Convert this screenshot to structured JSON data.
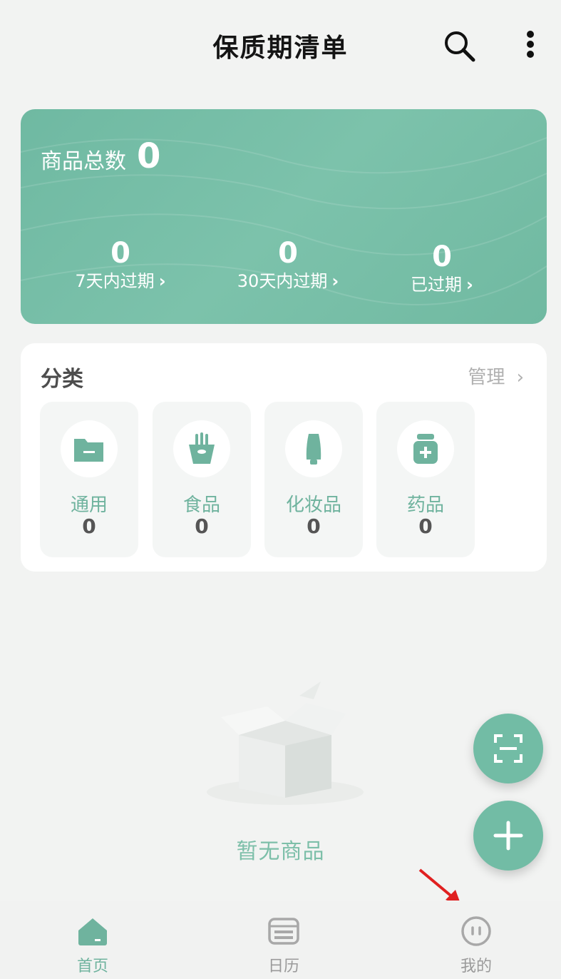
{
  "header": {
    "title": "保质期清单",
    "search_icon": "search-icon",
    "more_icon": "more-vertical-icon"
  },
  "stats": {
    "total_label": "商品总数",
    "total_value": "0",
    "items": [
      {
        "value": "0",
        "label": "7天内过期",
        "chevron": "›"
      },
      {
        "value": "0",
        "label": "30天内过期",
        "chevron": "›"
      },
      {
        "value": "0",
        "label": "已过期",
        "chevron": "›"
      }
    ]
  },
  "categories": {
    "title": "分类",
    "manage_label": "管理",
    "manage_chevron": "›",
    "items": [
      {
        "name": "通用",
        "count": "0",
        "icon": "folder-minus-icon"
      },
      {
        "name": "食品",
        "count": "0",
        "icon": "fries-icon"
      },
      {
        "name": "化妆品",
        "count": "0",
        "icon": "bottle-icon"
      },
      {
        "name": "药品",
        "count": "0",
        "icon": "medicine-jar-icon"
      }
    ]
  },
  "empty": {
    "text": "暂无商品",
    "icon": "empty-box-icon"
  },
  "fabs": {
    "scan_icon": "scan-icon",
    "add_icon": "plus-icon"
  },
  "tabbar": {
    "items": [
      {
        "label": "首页",
        "icon": "home-icon",
        "active": true
      },
      {
        "label": "日历",
        "icon": "calendar-icon",
        "active": false
      },
      {
        "label": "我的",
        "icon": "profile-face-icon",
        "active": false
      }
    ]
  },
  "colors": {
    "accent": "#72bca5",
    "card_bg": "#ffffff",
    "page_bg": "#f2f3f2",
    "active_tab": "#6fb39e",
    "inactive_tab": "#9a9a9a",
    "annotation_arrow": "#e02020"
  }
}
